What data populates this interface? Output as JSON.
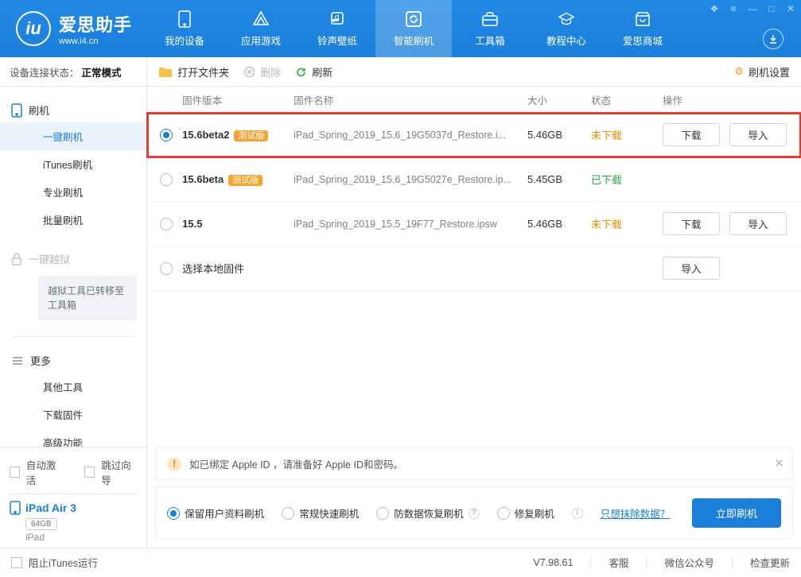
{
  "app": {
    "title": "爱思助手",
    "subtitle": "www.i4.cn"
  },
  "nav": [
    {
      "label": "我的设备"
    },
    {
      "label": "应用游戏"
    },
    {
      "label": "铃声壁纸"
    },
    {
      "label": "智能刷机"
    },
    {
      "label": "工具箱"
    },
    {
      "label": "教程中心"
    },
    {
      "label": "爱思商城"
    }
  ],
  "status": {
    "label": "设备连接状态：",
    "value": "正常模式"
  },
  "sidebar": {
    "flash": {
      "head": "刷机",
      "items": [
        "一键刷机",
        "iTunes刷机",
        "专业刷机",
        "批量刷机"
      ]
    },
    "jailbreak": {
      "head": "一键越狱",
      "note": "越狱工具已转移至工具箱"
    },
    "more": {
      "head": "更多",
      "items": [
        "其他工具",
        "下载固件",
        "高级功能"
      ]
    }
  },
  "devicePane": {
    "auto_activate": "自动激活",
    "skip_guide": "跳过向导",
    "name": "iPad Air 3",
    "storage": "64GB",
    "type": "iPad"
  },
  "toolbar": {
    "open_folder": "打开文件夹",
    "delete": "删除",
    "refresh": "刷新",
    "settings": "刷机设置"
  },
  "columns": {
    "version": "固件版本",
    "filename": "固件名称",
    "size": "大小",
    "status": "状态",
    "ops": "操作"
  },
  "rows": [
    {
      "selected": true,
      "version": "15.6beta2",
      "beta": "测试版",
      "filename": "iPad_Spring_2019_15.6_19G5037d_Restore.i...",
      "size": "5.46GB",
      "status": "未下载",
      "status_cls": "nd",
      "download": "下载",
      "import": "导入",
      "hl": true
    },
    {
      "selected": false,
      "version": "15.6beta",
      "beta": "测试版",
      "filename": "iPad_Spring_2019_15.6_19G5027e_Restore.ip...",
      "size": "5.45GB",
      "status": "已下载",
      "status_cls": "dl"
    },
    {
      "selected": false,
      "version": "15.5",
      "beta": "",
      "filename": "iPad_Spring_2019_15.5_19F77_Restore.ipsw",
      "size": "5.46GB",
      "status": "未下载",
      "status_cls": "nd",
      "download": "下载",
      "import": "导入"
    },
    {
      "selected": false,
      "version": "",
      "beta": "",
      "filename_main": "选择本地固件",
      "import": "导入"
    }
  ],
  "notice": "如已绑定 Apple ID ，请准备好 Apple ID和密码。",
  "options": {
    "keep_data": "保留用户资料刷机",
    "fast": "常规快速刷机",
    "anti": "防数据恢复刷机",
    "repair": "修复刷机",
    "erase_link": "只想抹除数据？",
    "go": "立即刷机"
  },
  "footer": {
    "block_itunes": "阻止iTunes运行",
    "version": "V7.98.61",
    "service": "客服",
    "wechat": "微信公众号",
    "update": "检查更新"
  }
}
